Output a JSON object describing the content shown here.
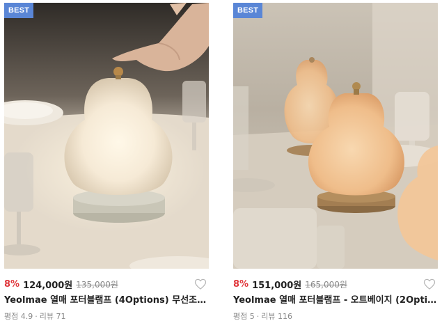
{
  "products": [
    {
      "badge": "BEST",
      "discount": "8%",
      "price": "124,000원",
      "original_price": "135,000원",
      "title": "Yeolmae 열매 포터블램프 (4Options) 무선조명 ...",
      "rating_label": "평점 4.9",
      "separator": "·",
      "reviews_label": "리뷰 71",
      "image": "pear-shaped-portable-lamp-touch"
    },
    {
      "badge": "BEST",
      "discount": "8%",
      "price": "151,000원",
      "original_price": "165,000원",
      "title": "Yeolmae 열매 포터블램프 - 오트베이지 (2Optio...",
      "rating_label": "평점 5",
      "separator": "·",
      "reviews_label": "리뷰 116",
      "image": "pear-shaped-lamps-on-table"
    }
  ],
  "colors": {
    "badge": "#5a86d6",
    "discount": "#e0373c",
    "price": "#222222",
    "muted": "#888888"
  }
}
